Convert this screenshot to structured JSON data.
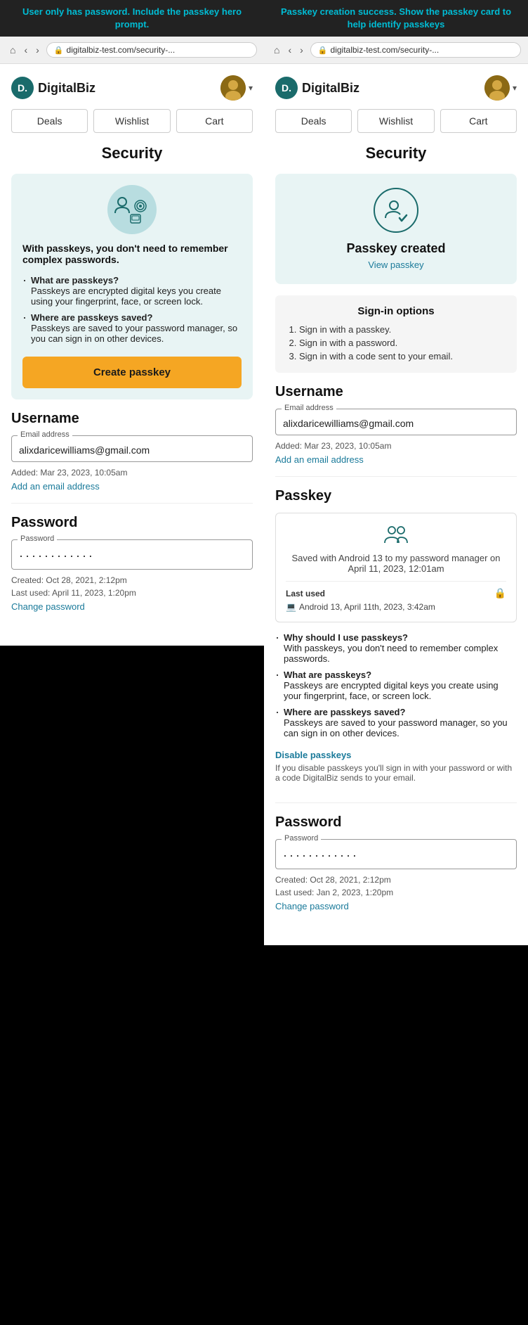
{
  "banners": {
    "left": "User only has password. Include the passkey hero prompt.",
    "right": "Passkey creation success. Show the passkey card to help identify passkeys"
  },
  "left_panel": {
    "url": "digitalbiz-test.com/security-...",
    "logo": "D.",
    "brand": "DigitalBiz",
    "nav": [
      "Deals",
      "Wishlist",
      "Cart"
    ],
    "page_title": "Security",
    "hero": {
      "bold_text": "With passkeys, you don't need to remember complex passwords.",
      "items": [
        {
          "title": "What are passkeys?",
          "desc": "Passkeys are encrypted digital keys you create using your fingerprint, face, or screen lock."
        },
        {
          "title": "Where are passkeys saved?",
          "desc": "Passkeys are saved to your password manager, so you can sign in on other devices."
        }
      ],
      "btn_label": "Create passkey"
    },
    "username_section": {
      "title": "Username",
      "email_label": "Email address",
      "email_value": "alixdaricewilliams@gmail.com",
      "added_meta": "Added: Mar 23, 2023, 10:05am",
      "add_link": "Add an email address"
    },
    "password_section": {
      "title": "Password",
      "password_label": "Password",
      "password_dots": "············",
      "created_meta": "Created: Oct 28, 2021, 2:12pm",
      "last_used_meta": "Last used: April 11, 2023, 1:20pm",
      "change_link": "Change password"
    }
  },
  "right_panel": {
    "url": "digitalbiz-test.com/security-...",
    "logo": "D.",
    "brand": "DigitalBiz",
    "nav": [
      "Deals",
      "Wishlist",
      "Cart"
    ],
    "page_title": "Security",
    "passkey_created_card": {
      "title": "Passkey created",
      "view_link": "View passkey"
    },
    "sign_in_options": {
      "title": "Sign-in options",
      "items": [
        "Sign in with a passkey.",
        "Sign in with a password.",
        "Sign in with a code sent to your email."
      ]
    },
    "username_section": {
      "title": "Username",
      "email_label": "Email address",
      "email_value": "alixdaricewilliams@gmail.com",
      "added_meta": "Added: Mar 23, 2023, 10:05am",
      "add_link": "Add an email address"
    },
    "passkey_section": {
      "title": "Passkey",
      "card": {
        "device_text": "Saved with Android 13 to my password manager on April 11, 2023, 12:01am",
        "last_used_label": "Last used",
        "last_used_device": "Android 13, April 11th, 2023, 3:42am"
      },
      "faq": [
        {
          "title": "Why should I use passkeys?",
          "desc": "With passkeys, you don't need to remember complex passwords."
        },
        {
          "title": "What are passkeys?",
          "desc": "Passkeys are encrypted digital keys you create using your fingerprint, face, or screen lock."
        },
        {
          "title": "Where are passkeys saved?",
          "desc": "Passkeys are saved to your password manager, so you can sign in on other devices."
        }
      ],
      "disable_link": "Disable passkeys",
      "disable_desc": "If you disable passkeys you'll sign in with your password or with a code DigitalBiz sends to your email."
    },
    "password_section": {
      "title": "Password",
      "password_label": "Password",
      "password_dots": "············",
      "created_meta": "Created: Oct 28, 2021, 2:12pm",
      "last_used_meta": "Last used: Jan 2, 2023, 1:20pm",
      "change_link": "Change password"
    }
  }
}
